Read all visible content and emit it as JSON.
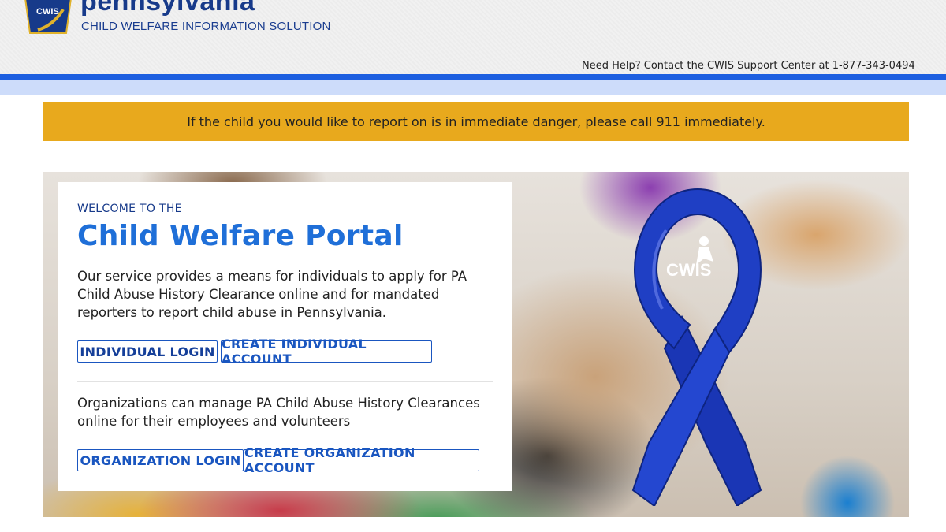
{
  "header": {
    "brand_name": "pennsylvania",
    "brand_subtitle": "CHILD WELFARE INFORMATION SOLUTION",
    "logo_text": "CWIS",
    "help_text": "Need Help? Contact the CWIS Support Center at 1-877-343-0494"
  },
  "alert": {
    "text": "If the child you would like to report on is in immediate danger, please call 911 immediately."
  },
  "welcome": {
    "eyebrow": "WELCOME TO THE",
    "title": "Child Welfare Portal",
    "individual_description": "Our service provides a means for individuals to apply for PA Child Abuse History Clearance online and for mandated reporters to report child abuse in Pennsylvania.",
    "individual_login_label": "INDIVIDUAL LOGIN",
    "create_individual_label": "CREATE INDIVIDUAL ACCOUNT",
    "organization_description": "Organizations can manage PA Child Abuse History Clearances online for their employees and volunteers",
    "organization_login_label": "ORGANIZATION LOGIN",
    "create_organization_label": "CREATE ORGANIZATION ACCOUNT"
  },
  "hero": {
    "ribbon_text": "CWIS",
    "ribbon_color": "#1f3fc4"
  },
  "colors": {
    "accent_blue": "#1d5fe0",
    "alert_bg": "#e8a91d",
    "title_blue": "#1f6fd8"
  }
}
